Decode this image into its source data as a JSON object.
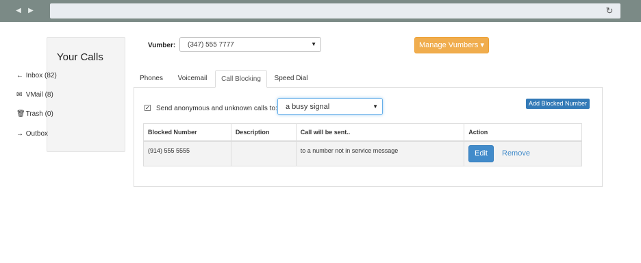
{
  "browser": {
    "back_icon": "◀",
    "forward_icon": "▶",
    "reload_icon": "↻"
  },
  "sidebar": {
    "title": "Your Calls",
    "items": [
      {
        "icon": "←",
        "icon_name": "arrow-left-icon",
        "label": "Inbox (82)"
      },
      {
        "icon": "✉",
        "icon_name": "envelope-icon",
        "label": "VMail (8)"
      },
      {
        "icon": "🗑",
        "icon_name": "trash-icon",
        "label": "Trash (0)"
      },
      {
        "icon": "→",
        "icon_name": "arrow-right-icon",
        "label": "Outbox"
      }
    ]
  },
  "vumber": {
    "label": "Vumber:",
    "value": "(347) 555 7777"
  },
  "manage_button": "Manage Vumbers ▾",
  "tabs": [
    "Phones",
    "Voicemail",
    "Call Blocking",
    "Speed Dial"
  ],
  "active_tab": "Call Blocking",
  "blocking": {
    "checkbox_checked": true,
    "checkbox_label": "Send anonymous and unknown calls to:",
    "signal_value": "a busy signal",
    "add_button": "Add Blocked Number"
  },
  "table": {
    "headers": [
      "Blocked Number",
      "Description",
      "Call will be sent..",
      "Action"
    ],
    "rows": [
      {
        "number": "(914) 555 5555",
        "description": "",
        "sent_to": "to a number not in service message",
        "edit": "Edit",
        "remove": "Remove"
      }
    ]
  },
  "colors": {
    "chrome": "#7b8a86",
    "manage_button": "#f0ad4e",
    "primary": "#337ab7",
    "edit_button": "#428bca"
  }
}
